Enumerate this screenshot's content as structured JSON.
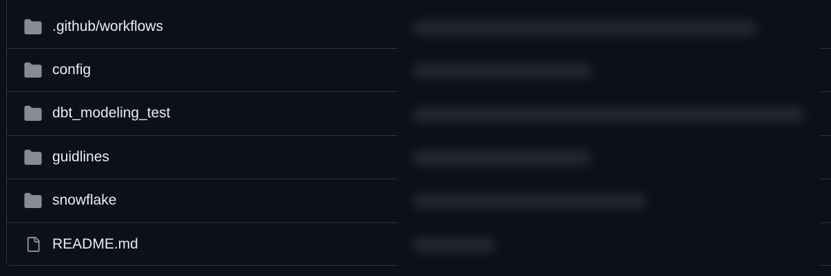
{
  "files": [
    {
      "name": ".github/workflows",
      "type": "folder",
      "icon": "folder-icon"
    },
    {
      "name": "config",
      "type": "folder",
      "icon": "folder-icon"
    },
    {
      "name": "dbt_modeling_test",
      "type": "folder",
      "icon": "folder-icon"
    },
    {
      "name": "guidlines",
      "type": "folder",
      "icon": "folder-icon"
    },
    {
      "name": "snowflake",
      "type": "folder",
      "icon": "folder-icon"
    },
    {
      "name": "README.md",
      "type": "file",
      "icon": "file-icon"
    }
  ],
  "colors": {
    "background": "#0d1117",
    "border": "#30363d",
    "text": "#e6edf3",
    "icon": "#848d97"
  }
}
